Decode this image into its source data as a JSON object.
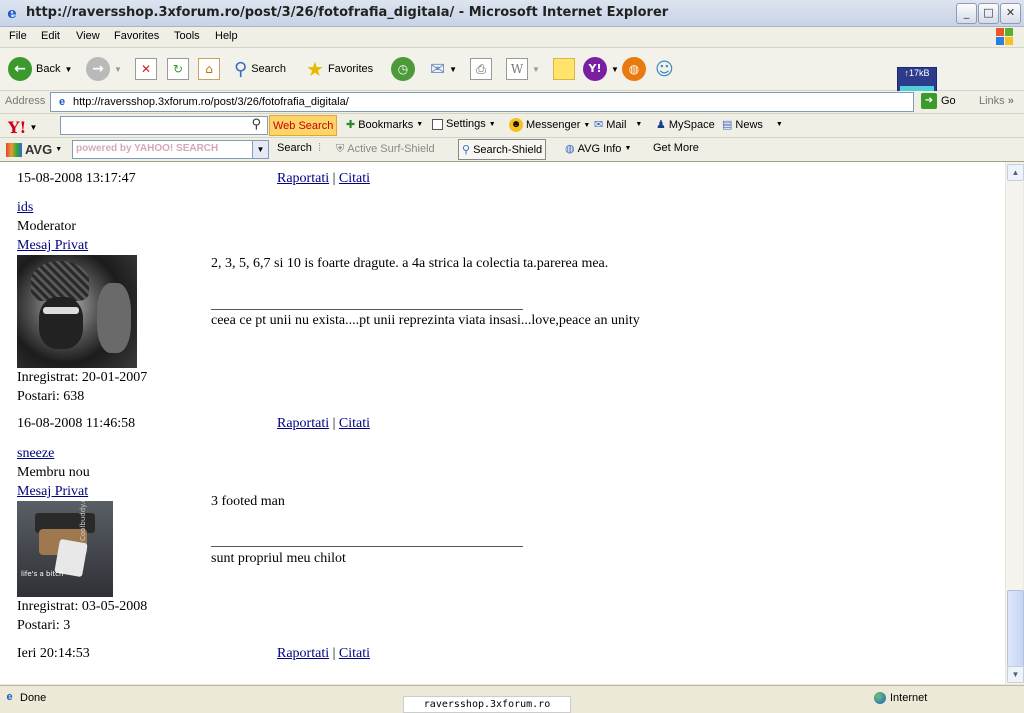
{
  "window": {
    "title": "http://raversshop.3xforum.ro/post/3/26/fotofrafia_digitala/ - Microsoft Internet Explorer",
    "min": "_",
    "max": "□",
    "close": "✕"
  },
  "menu": [
    "File",
    "Edit",
    "View",
    "Favorites",
    "Tools",
    "Help"
  ],
  "toolbar": {
    "back": "Back",
    "search": "Search",
    "favorites": "Favorites"
  },
  "address": {
    "label": "Address",
    "url": "http://raversshop.3xforum.ro/post/3/26/fotofrafia_digitala/",
    "go": "Go",
    "links": "Links",
    "meter": "↑17kB"
  },
  "yahoo_toolbar": {
    "web_search": "Web Search",
    "bookmarks": "Bookmarks",
    "settings": "Settings",
    "messenger": "Messenger",
    "mail": "Mail",
    "myspace": "MySpace",
    "news": "News"
  },
  "avg_toolbar": {
    "avg": "AVG",
    "search_placeholder": "powered by YAHOO! SEARCH",
    "search": "Search",
    "active_surf_shield": "Active  Surf-Shield",
    "search_shield": "Search-Shield",
    "avg_info": "AVG Info",
    "get_more": "Get More"
  },
  "posts": [
    {
      "timestamp": "15-08-2008 13:17:47",
      "report": "Raportati",
      "sep": "|",
      "quote": "Citati"
    },
    {
      "user": "ids",
      "role": "Moderator",
      "pm": "Mesaj Privat",
      "registered": "Inregistrat: 20-01-2007",
      "posts": "Postari: 638",
      "message": "2, 3, 5, 6,7 si 10 is foarte dragute. a 4a strica la colectia ta.parerea mea.",
      "signature": "ceea ce pt unii nu exista....pt unii reprezinta viata insasi...love,peace an unity",
      "timestamp": "16-08-2008 11:46:58",
      "report": "Raportati",
      "sep": "|",
      "quote": "Citati"
    },
    {
      "user": "sneeze",
      "role": "Membru nou",
      "pm": "Mesaj Privat",
      "avatar_text": "life's a bitch",
      "avatar_side": "Coolbuddy.com",
      "registered": "Inregistrat: 03-05-2008",
      "posts": "Postari: 3",
      "message": "3 footed man",
      "signature": "sunt propriul meu chilot",
      "timestamp": "Ieri 20:14:53",
      "report": "Raportati",
      "sep": "|",
      "quote": "Citati"
    }
  ],
  "status": {
    "done": "Done",
    "zone": "Internet",
    "tooltip": "raversshop.3xforum.ro"
  }
}
